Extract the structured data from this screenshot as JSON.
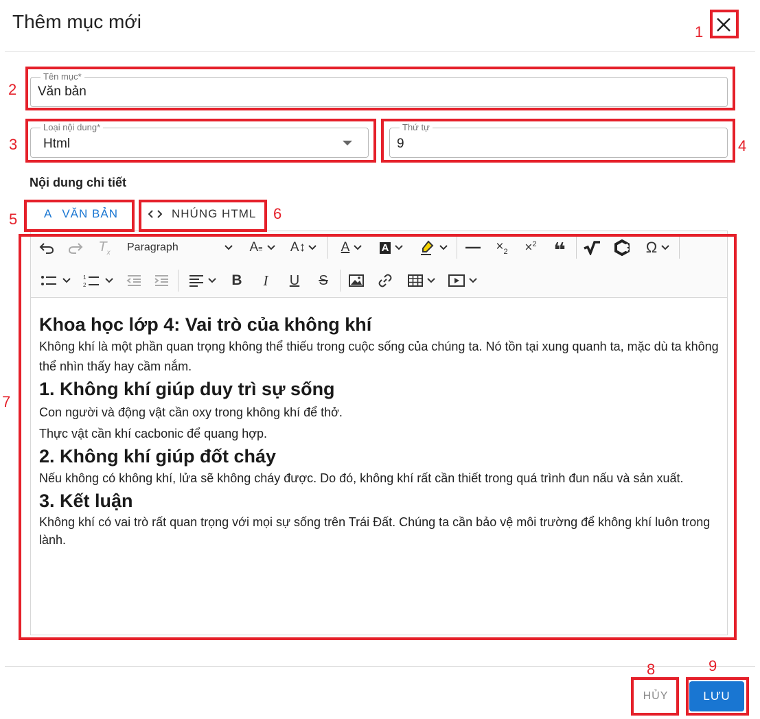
{
  "dialog": {
    "title": "Thêm mục mới"
  },
  "form": {
    "name": {
      "label": "Tên mục*",
      "value": "Văn bản"
    },
    "content_type": {
      "label": "Loại nội dung*",
      "value": "Html"
    },
    "order": {
      "label": "Thứ tự",
      "value": "9"
    },
    "detail_label": "Nội dung chi tiết"
  },
  "tabs": [
    {
      "label": "VĂN BẢN",
      "icon": "text-a-icon",
      "active": true
    },
    {
      "label": "NHÚNG HTML",
      "icon": "code-icon",
      "active": false
    }
  ],
  "toolbar": {
    "paragraph_label": "Paragraph"
  },
  "content": {
    "title": "Khoa học lớp 4: Vai trò của không khí",
    "intro": "Không khí là một phần quan trọng không thể thiếu trong cuộc sống của chúng ta. Nó tồn tại xung quanh ta, mặc dù ta không thể nhìn thấy hay cầm nắm.",
    "s1_heading": "1. Không khí giúp duy trì sự sống",
    "s1_line1": "Con người và động vật cần oxy trong không khí để thở.",
    "s1_line2": "Thực vật cần khí cacbonic để quang hợp.",
    "s2_heading": "2. Không khí giúp đốt cháy",
    "s2_text": "Nếu không có không khí, lửa sẽ không cháy được. Do đó, không khí rất cần thiết trong quá trình đun nấu và sản xuất.",
    "s3_heading": "3. Kết luận",
    "s3_text": "Không khí có vai trò rất quan trọng với mọi sự sống trên Trái Đất. Chúng ta cần bảo vệ môi trường để không khí luôn trong lành."
  },
  "actions": {
    "cancel": "HỦY",
    "save": "LƯU"
  },
  "markers": [
    "1",
    "2",
    "3",
    "4",
    "5",
    "6",
    "7",
    "8",
    "9"
  ],
  "colors": {
    "primary": "#1976d2",
    "annotation": "#e5202a"
  }
}
